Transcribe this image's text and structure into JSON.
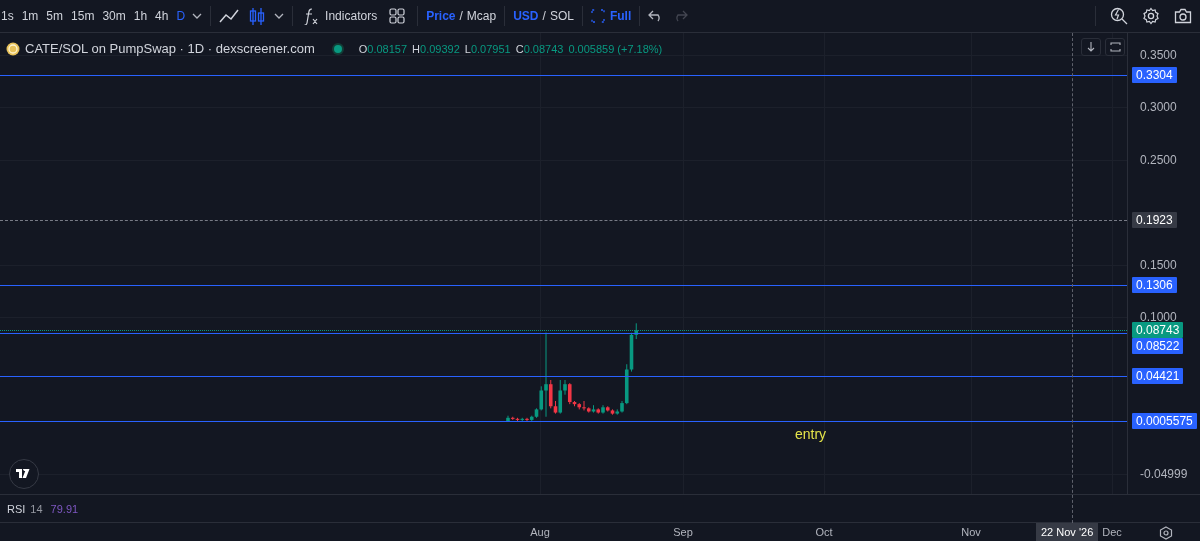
{
  "toolbar": {
    "intervals": [
      {
        "label": "1s",
        "selected": false
      },
      {
        "label": "1m",
        "selected": false
      },
      {
        "label": "5m",
        "selected": false
      },
      {
        "label": "15m",
        "selected": false
      },
      {
        "label": "30m",
        "selected": false
      },
      {
        "label": "1h",
        "selected": false
      },
      {
        "label": "4h",
        "selected": false
      },
      {
        "label": "D",
        "selected": true
      }
    ],
    "chart_styles": [
      {
        "kind": "line",
        "selected": false
      },
      {
        "kind": "candles",
        "selected": true
      }
    ],
    "indicators_label": "Indicators",
    "toggles": [
      {
        "separator": "/",
        "options": [
          {
            "label": "Price",
            "selected": true
          },
          {
            "label": "Mcap",
            "selected": false
          }
        ]
      },
      {
        "separator": "/",
        "options": [
          {
            "label": "USD",
            "selected": true
          },
          {
            "label": "SOL",
            "selected": false
          }
        ]
      }
    ],
    "full_label": "Full",
    "undo": {
      "disabled": false
    },
    "redo": {
      "disabled": true
    }
  },
  "legend": {
    "title": "CATE/SOL on PumpSwap · 1D · dexscreener.com",
    "ohlc": [
      {
        "key": "O",
        "value": "0.08157"
      },
      {
        "key": "H",
        "value": "0.09392"
      },
      {
        "key": "L",
        "value": "0.07951"
      },
      {
        "key": "C",
        "value": "0.08743"
      }
    ],
    "change": "0.005859 (+7.18%)"
  },
  "price_axis": {
    "ticks": [
      "0.3500",
      "0.3000",
      "0.2500",
      "0.1500",
      "0.1000",
      "-0.04999"
    ]
  },
  "price_lines": [
    {
      "kind": "line",
      "label": "0.3304",
      "color": "#2962ff"
    },
    {
      "kind": "crosshair",
      "label": "0.1923",
      "color": "#363a45"
    },
    {
      "kind": "line",
      "label": "0.1306",
      "color": "#2962ff"
    },
    {
      "kind": "last",
      "label": "0.08743",
      "color": "#089981"
    },
    {
      "kind": "line",
      "label": "0.08522",
      "color": "#2962ff"
    },
    {
      "kind": "line",
      "label": "0.04421",
      "color": "#2962ff"
    },
    {
      "kind": "line",
      "label": "0.0005575",
      "color": "#2962ff"
    }
  ],
  "annotation": {
    "text": "entry"
  },
  "rsi": {
    "name": "RSI",
    "length": "14",
    "value": "79.91"
  },
  "time_axis": {
    "labels": [
      "Aug",
      "Sep",
      "Oct",
      "Nov",
      "Dec"
    ],
    "crosshair_label": "22 Nov '26"
  }
}
